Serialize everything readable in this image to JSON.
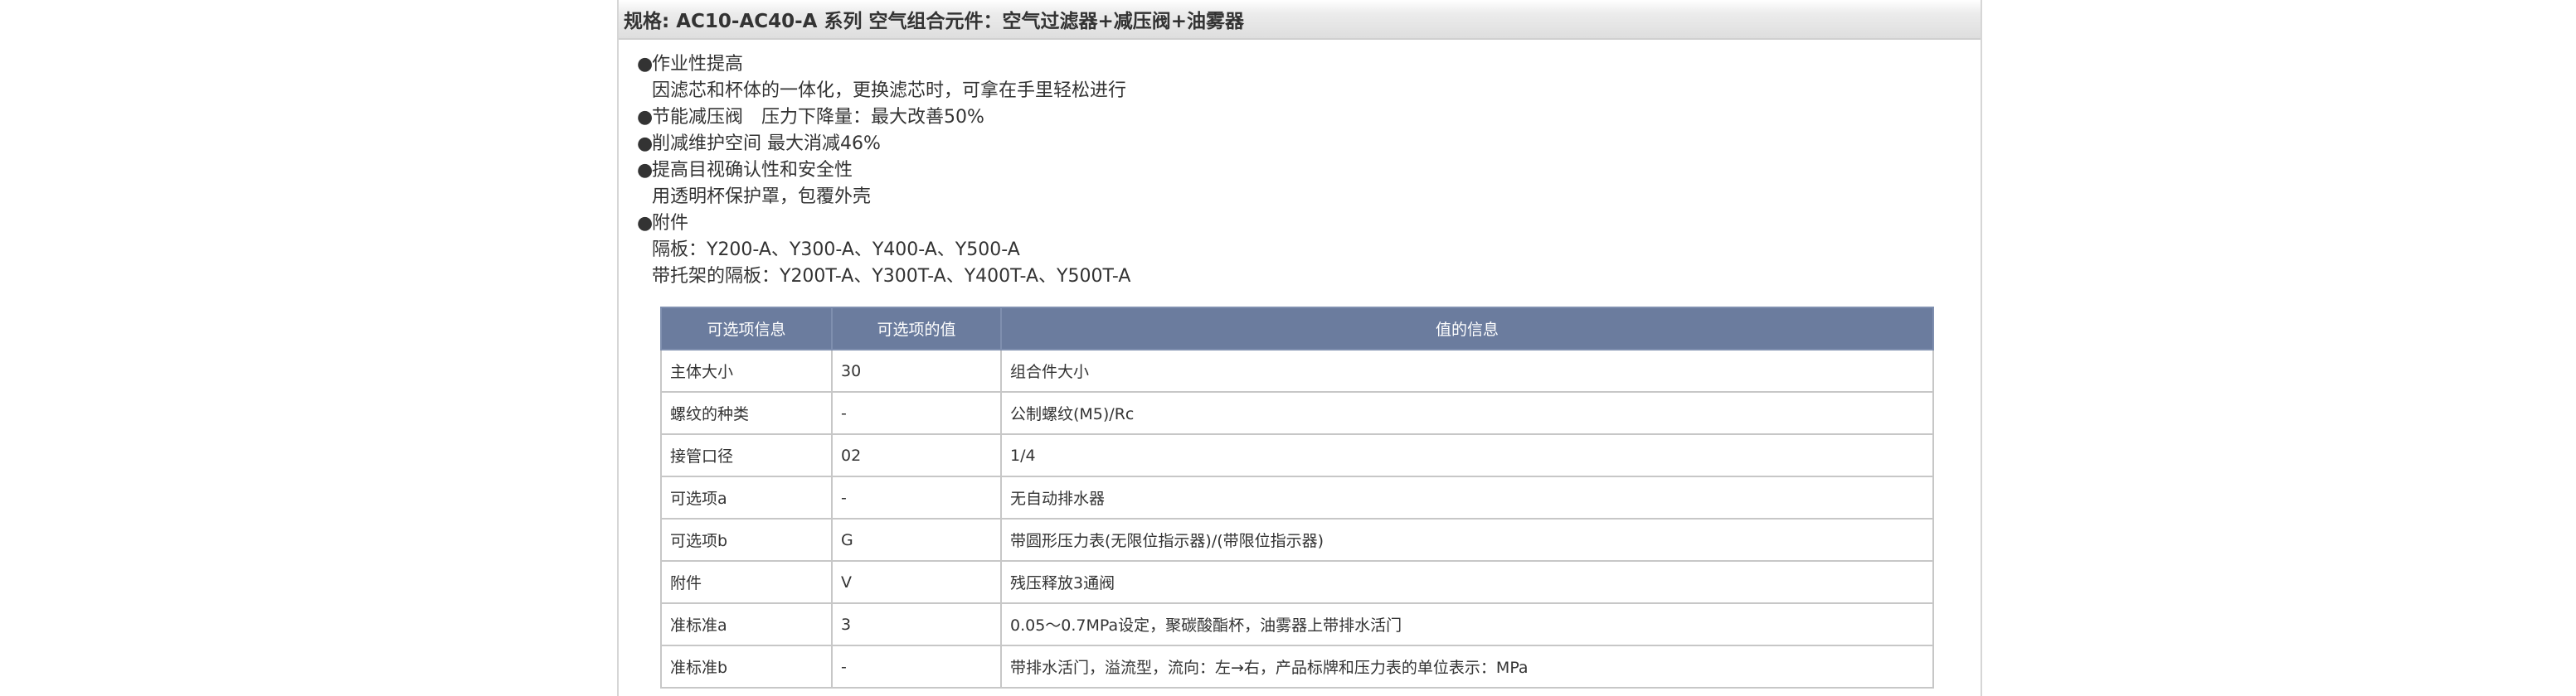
{
  "title": "规格: AC10-AC40-A 系列 空气组合元件：空气过滤器+减压阀+油雾器",
  "features": [
    {
      "bullet": true,
      "text": "作业性提高"
    },
    {
      "bullet": false,
      "text": "因滤芯和杯体的一体化，更换滤芯时，可拿在手里轻松进行"
    },
    {
      "bullet": true,
      "text": "节能减压阀　压力下降量：最大改善50%"
    },
    {
      "bullet": true,
      "text": "削减维护空间 最大消减46%"
    },
    {
      "bullet": true,
      "text": "提高目视确认性和安全性"
    },
    {
      "bullet": false,
      "text": "用透明杯保护罩，包覆外壳"
    },
    {
      "bullet": true,
      "text": "附件"
    },
    {
      "bullet": false,
      "text": "隔板：Y200-A、Y300-A、Y400-A、Y500-A"
    },
    {
      "bullet": false,
      "text": "带托架的隔板：Y200T-A、Y300T-A、Y400T-A、Y500T-A"
    }
  ],
  "bullet_char": "●",
  "table": {
    "headers": [
      "可选项信息",
      "可选项的值",
      "值的信息"
    ],
    "rows": [
      [
        "主体大小",
        "30",
        "组合件大小"
      ],
      [
        "螺纹的种类",
        "-",
        "公制螺纹(M5)/Rc"
      ],
      [
        "接管口径",
        "02",
        "1/4"
      ],
      [
        "可选项a",
        "-",
        "无自动排水器"
      ],
      [
        "可选项b",
        "G",
        "带圆形压力表(无限位指示器)/(带限位指示器)"
      ],
      [
        "附件",
        "V",
        "残压释放3通阀"
      ],
      [
        "准标准a",
        "3",
        "0.05～0.7MPa设定，聚碳酸酯杯，油雾器上带排水活门"
      ],
      [
        "准标准b",
        "-",
        "带排水活门，溢流型，流向：左→右，产品标牌和压力表的单位表示：MPa"
      ]
    ]
  },
  "colors": {
    "header_bg": "#6b7c9e",
    "title_bar_bg": "#e4e4e4"
  }
}
